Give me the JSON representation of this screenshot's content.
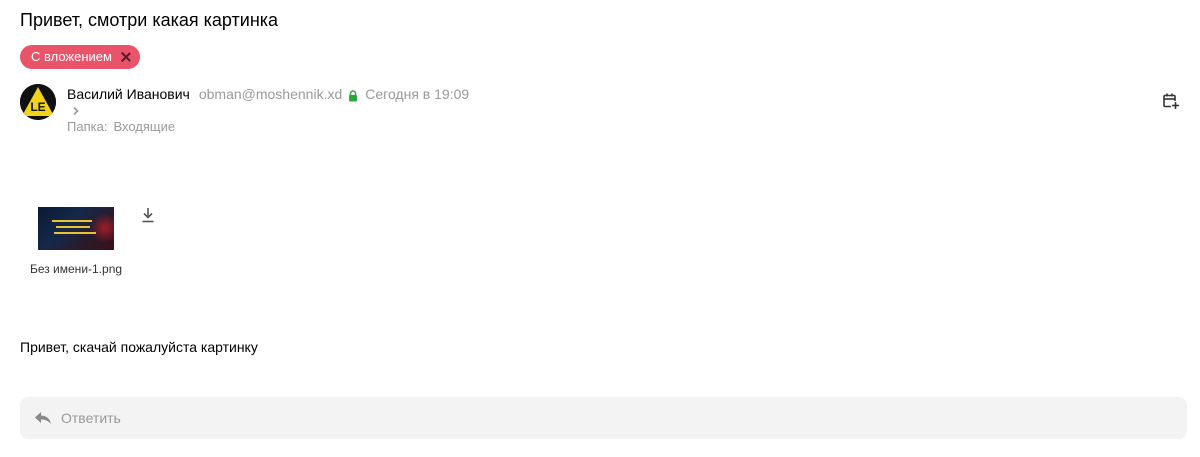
{
  "message": {
    "subject": "Привет, смотри какая картинка",
    "label": "С вложением",
    "sender_name": "Василий Иванович",
    "sender_email": "obman@moshennik.xd",
    "date": "Сегодня в 19:09",
    "folder_label": "Папка:",
    "folder_value": "Входящие",
    "body": "Привет, скачай пожалуйста картинку"
  },
  "avatar": {
    "initials": "LE",
    "colors": {
      "background": "#111111",
      "triangle": "#f2d21b",
      "text": "#111111"
    }
  },
  "attachment": {
    "name": "Без имени-1.png"
  },
  "reply": {
    "placeholder": "Ответить"
  },
  "icons": {
    "label_remove": "close-icon",
    "secure": "lock-icon",
    "expand": "chevron-right-icon",
    "calendar": "calendar-add-icon",
    "download": "download-icon",
    "reply": "reply-icon"
  },
  "colors": {
    "label_bg": "#e9546b",
    "secure_lock": "#27a83a",
    "muted_text": "#999999",
    "reply_bar_bg": "#f3f3f3"
  }
}
